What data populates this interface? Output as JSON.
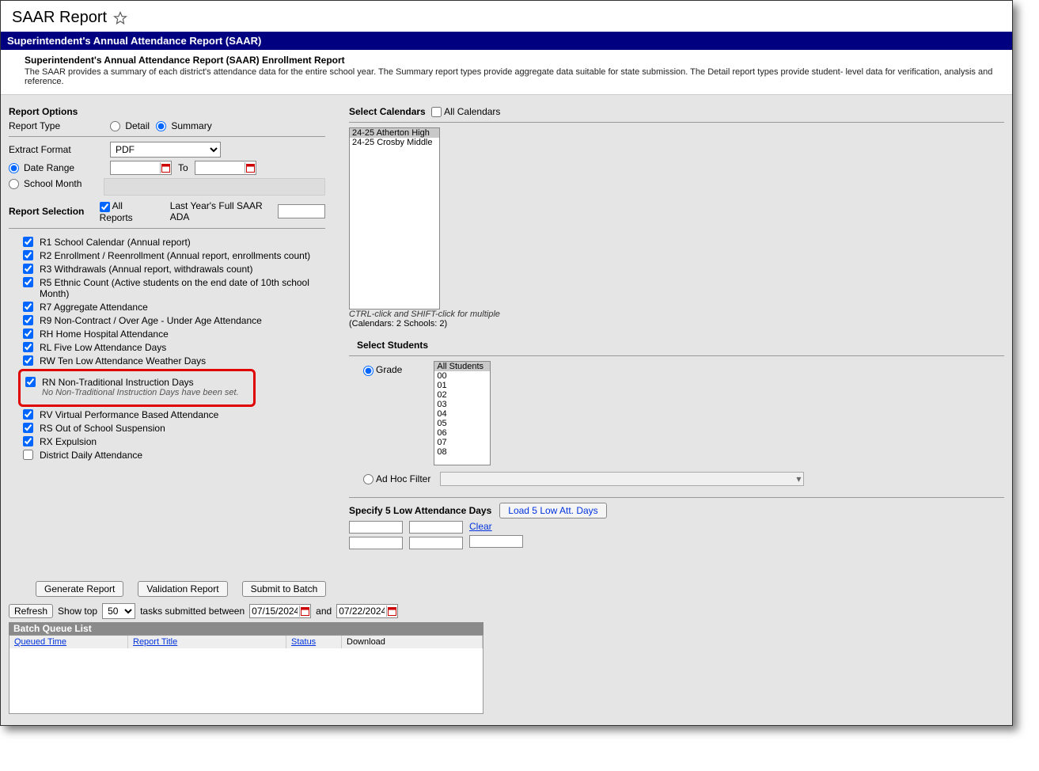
{
  "page_title": "SAAR Report",
  "banner_title": "Superintendent's Annual Attendance Report (SAAR)",
  "desc_title": "Superintendent's Annual Attendance Report (SAAR) Enrollment Report",
  "desc_body": "The SAAR provides a summary of each district's attendance data for the entire school year. The Summary report types provide aggregate data suitable for state submission. The Detail report types provide student- level data for verification, analysis and reference.",
  "report_options_header": "Report Options",
  "labels": {
    "report_type": "Report Type",
    "detail": "Detail",
    "summary": "Summary",
    "extract_format": "Extract Format",
    "date_range": "Date Range",
    "to": "To",
    "school_month": "School Month",
    "report_selection": "Report Selection",
    "all_reports": "All Reports",
    "last_year_ada": "Last Year's Full SAAR ADA",
    "select_calendars": "Select Calendars",
    "all_calendars": "All Calendars",
    "select_students": "Select Students",
    "grade": "Grade",
    "ad_hoc_filter": "Ad Hoc Filter",
    "specify_low_days": "Specify 5 Low Attendance Days",
    "load_low_days": "Load 5 Low Att. Days",
    "clear": "Clear",
    "generate_report": "Generate Report",
    "validation_report": "Validation Report",
    "submit_to_batch": "Submit to Batch",
    "refresh": "Refresh",
    "show_top": "Show top",
    "tasks_between": "tasks submitted between",
    "and": "and",
    "batch_queue_list": "Batch Queue List",
    "queued_time": "Queued Time",
    "report_title": "Report Title",
    "status": "Status",
    "download": "Download"
  },
  "extract_format_value": "PDF",
  "reports": [
    {
      "label": "R1 School Calendar (Annual report)",
      "checked": true
    },
    {
      "label": "R2 Enrollment / Reenrollment (Annual report, enrollments count)",
      "checked": true
    },
    {
      "label": "R3 Withdrawals (Annual report, withdrawals count)",
      "checked": true
    },
    {
      "label": "R5 Ethnic Count (Active students on the end date of 10th school Month)",
      "checked": true
    },
    {
      "label": "R7 Aggregate Attendance",
      "checked": true
    },
    {
      "label": "R9 Non-Contract / Over Age - Under Age Attendance",
      "checked": true
    },
    {
      "label": "RH Home Hospital Attendance",
      "checked": true
    },
    {
      "label": "RL Five Low Attendance Days",
      "checked": true
    },
    {
      "label": "RW Ten Low Attendance Weather Days",
      "checked": true
    }
  ],
  "highlighted_report": {
    "label": "RN Non-Traditional Instruction Days",
    "sub": "No Non-Traditional Instruction Days have been set."
  },
  "reports_after": [
    {
      "label": "RV Virtual Performance Based Attendance",
      "checked": true
    },
    {
      "label": "RS Out of School Suspension",
      "checked": true
    },
    {
      "label": "RX Expulsion",
      "checked": true
    },
    {
      "label": "District Daily Attendance",
      "checked": false
    }
  ],
  "calendars": [
    {
      "label": "24-25 Atherton High",
      "selected": true
    },
    {
      "label": "24-25 Crosby Middle",
      "selected": false
    }
  ],
  "calendar_hint": "CTRL-click and SHIFT-click for multiple",
  "calendar_counts": "(Calendars: 2  Schools: 2)",
  "grades": [
    "All Students",
    "00",
    "01",
    "02",
    "03",
    "04",
    "05",
    "06",
    "07",
    "08"
  ],
  "show_top_value": "50",
  "date_from": "07/15/2024",
  "date_to": "07/22/2024"
}
